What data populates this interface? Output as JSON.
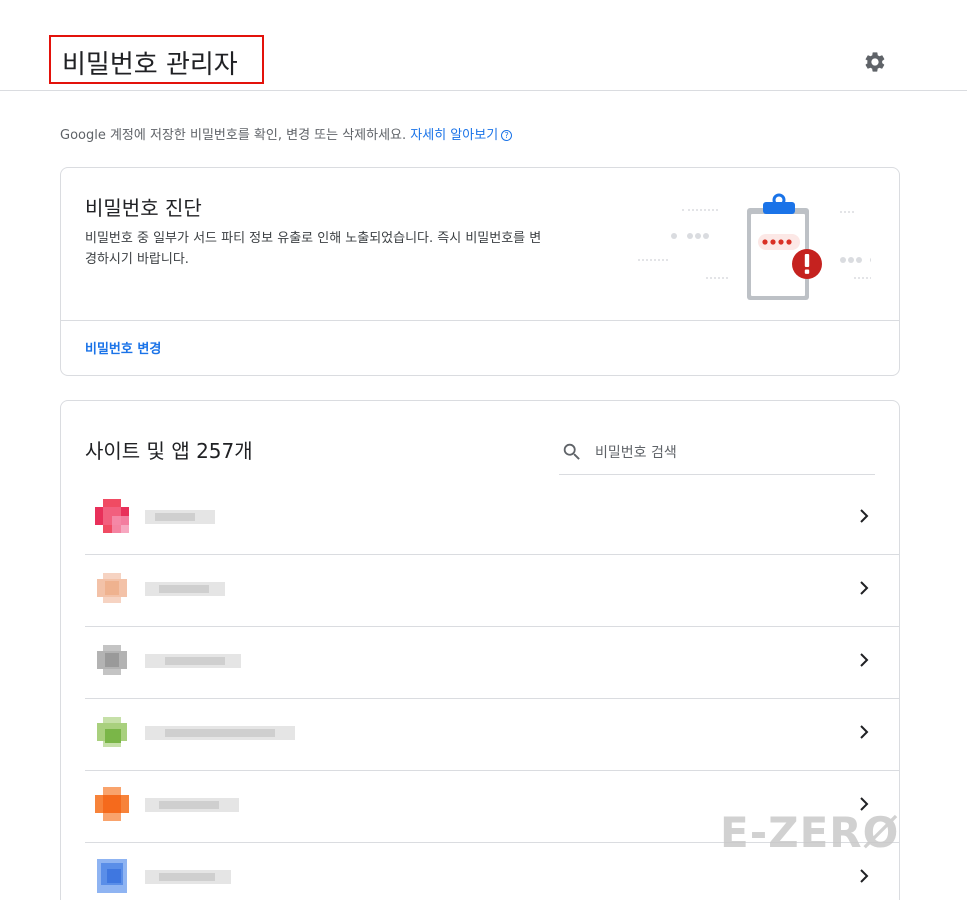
{
  "header": {
    "title": "비밀번호 관리자",
    "settings_icon": "gear-icon"
  },
  "description": {
    "text": "Google 계정에 저장한 비밀번호를 확인, 변경 또는 삭제하세요.",
    "learn_more": "자세히 알아보기",
    "help_icon": "?"
  },
  "checkup": {
    "title": "비밀번호 진단",
    "text": "비밀번호 중 일부가 서드 파티 정보 유출로 인해 노출되었습니다. 즉시 비밀번호를 변경하시기 바랍니다.",
    "action": "비밀번호 변경",
    "illustration": "clipboard-warning-icon"
  },
  "sites": {
    "title": "사이트 및 앱 257개",
    "search_placeholder": "비밀번호 검색",
    "rows": [
      {
        "favicon_color": "#e8305a",
        "name": ""
      },
      {
        "favicon_color": "#f3c2a8",
        "name": ""
      },
      {
        "favicon_color": "#a9a9a9",
        "name": ""
      },
      {
        "favicon_color": "#8cc063",
        "name": ""
      },
      {
        "favicon_color": "#f7833a",
        "name": ""
      },
      {
        "favicon_color": "#5a8ee8",
        "name": ""
      }
    ]
  },
  "watermark": "E-ZERØ",
  "colors": {
    "accent": "#1a73e8",
    "highlight_border": "#e3120b",
    "warning": "#c5221f",
    "divider": "#dadce0"
  }
}
